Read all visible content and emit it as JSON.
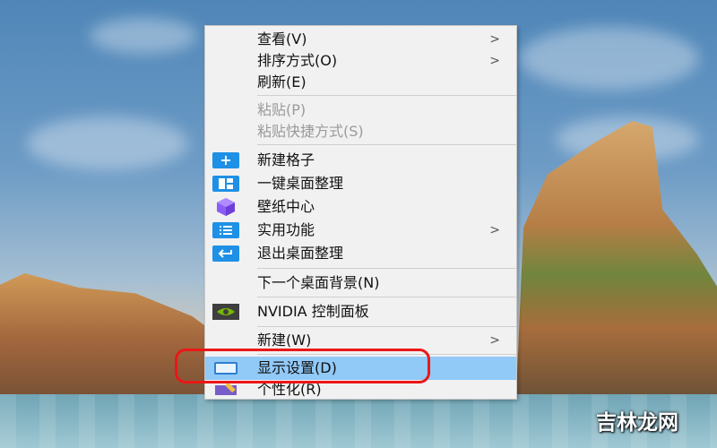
{
  "context_menu": {
    "items": [
      {
        "label": "查看(V)",
        "submenu": true,
        "icon": "none"
      },
      {
        "label": "排序方式(O)",
        "submenu": true,
        "icon": "none"
      },
      {
        "label": "刷新(E)",
        "submenu": false,
        "icon": "none"
      },
      {
        "label": "粘贴(P)",
        "submenu": false,
        "disabled": true,
        "icon": "none"
      },
      {
        "label": "粘贴快捷方式(S)",
        "submenu": false,
        "disabled": true,
        "icon": "none"
      },
      {
        "label": "新建格子",
        "submenu": false,
        "icon": "plus-icon"
      },
      {
        "label": "一键桌面整理",
        "submenu": false,
        "icon": "layout-icon"
      },
      {
        "label": "壁纸中心",
        "submenu": false,
        "icon": "cube-icon"
      },
      {
        "label": "实用功能",
        "submenu": true,
        "icon": "list-icon"
      },
      {
        "label": "退出桌面整理",
        "submenu": false,
        "icon": "exit-icon"
      },
      {
        "label": "下一个桌面背景(N)",
        "submenu": false,
        "icon": "none"
      },
      {
        "label": "NVIDIA 控制面板",
        "submenu": false,
        "icon": "nvidia-icon"
      },
      {
        "label": "新建(W)",
        "submenu": true,
        "icon": "none"
      },
      {
        "label": "显示设置(D)",
        "submenu": false,
        "highlighted": true,
        "icon": "display-icon"
      },
      {
        "label": "个性化(R)",
        "submenu": false,
        "icon": "personalize-icon"
      }
    ],
    "submenu_arrow": ">"
  },
  "watermark": "吉林龙网",
  "colors": {
    "highlight": "#91c9f7",
    "red_outline": "#ea1717",
    "icon_blue": "#1e90e6",
    "menu_bg": "#f1f1f1"
  }
}
